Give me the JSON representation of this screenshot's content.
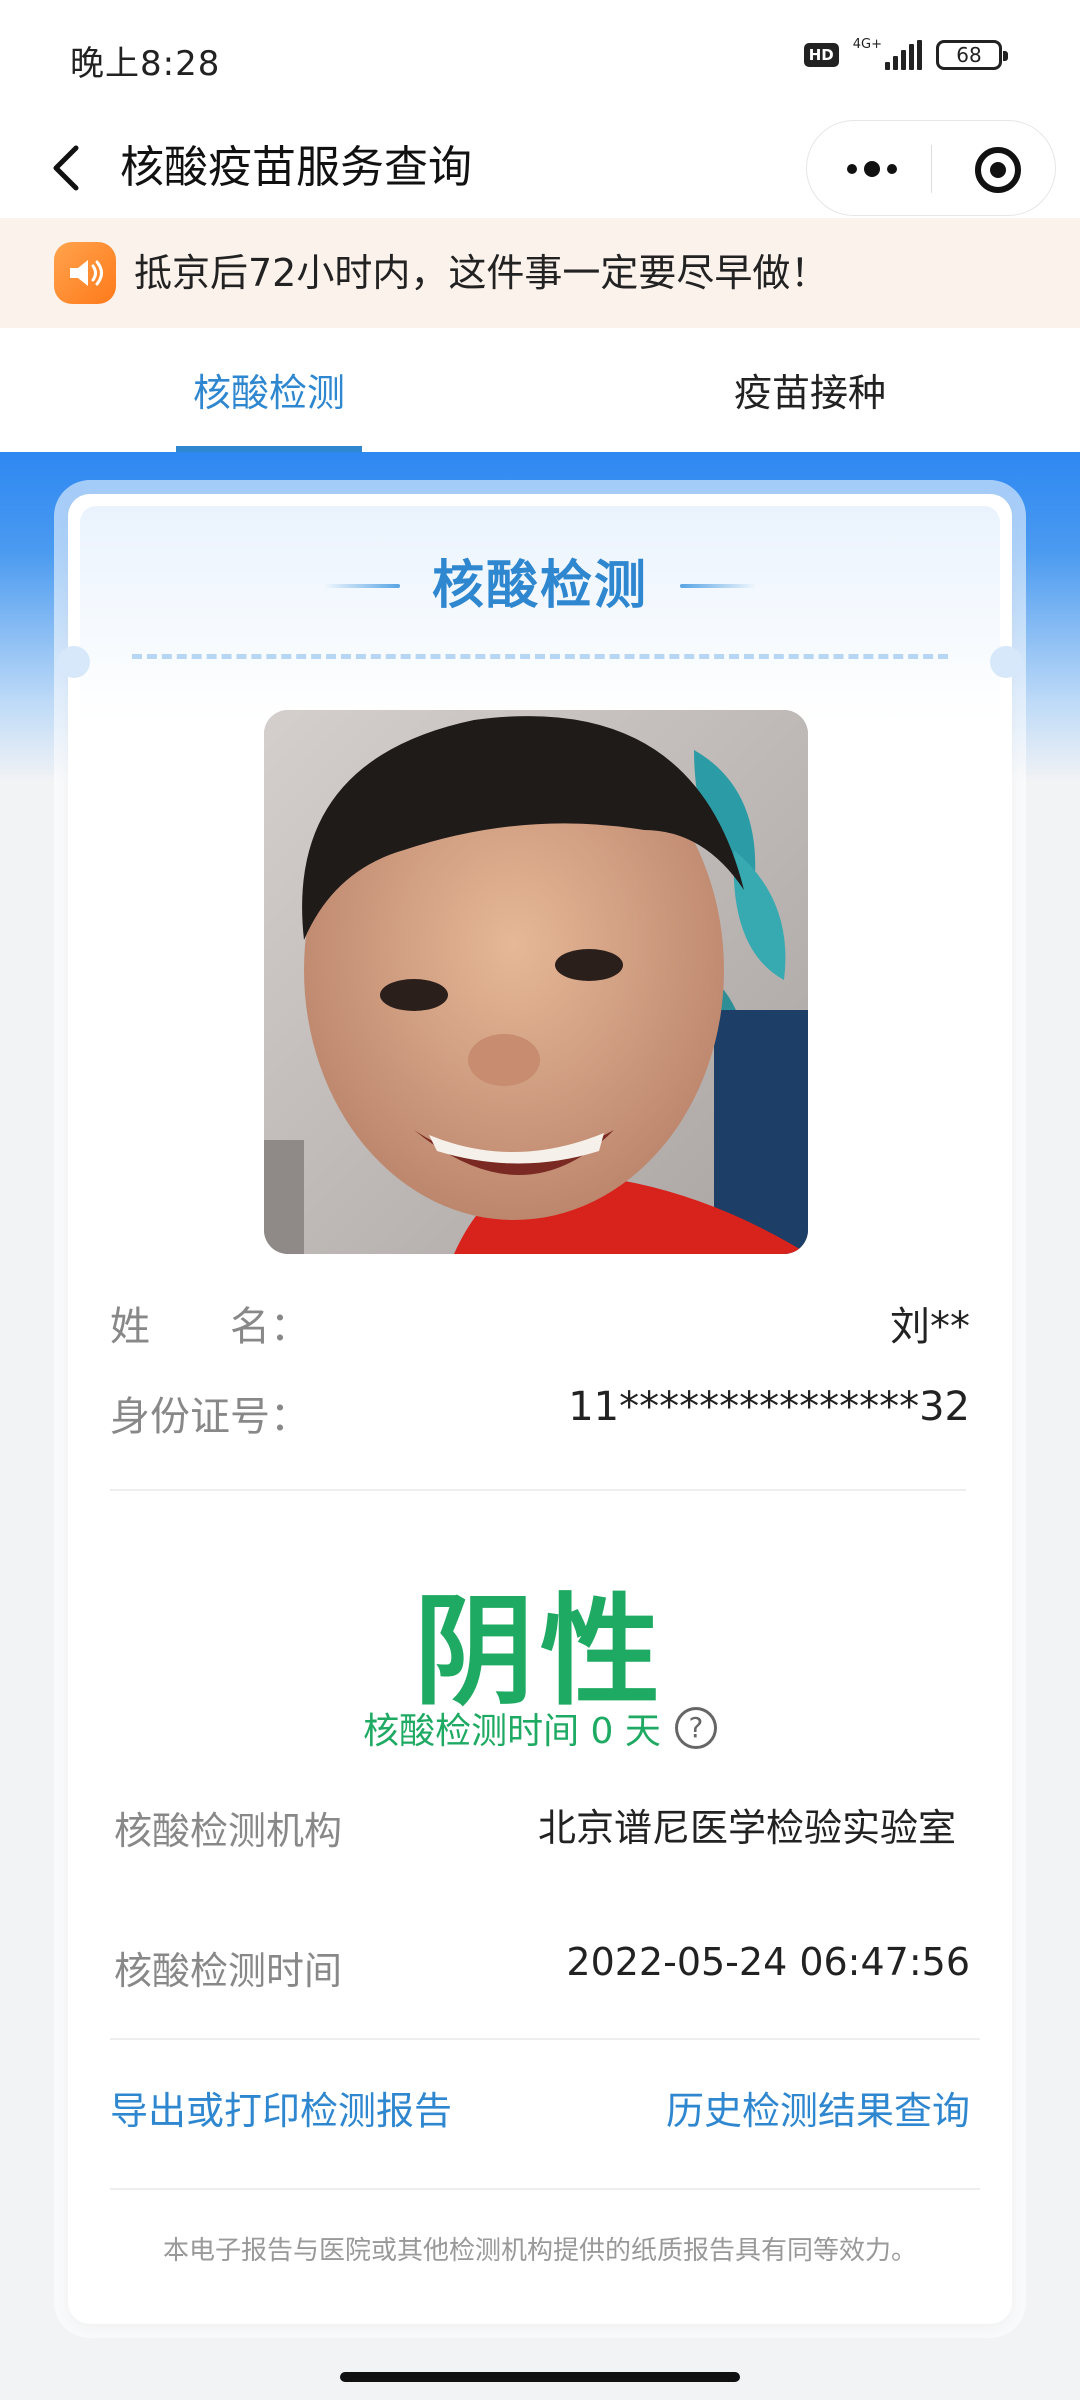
{
  "status_bar": {
    "time": "晚上8:28",
    "hd": "HD",
    "network": "4G+",
    "battery": "68"
  },
  "nav": {
    "title": "核酸疫苗服务查询"
  },
  "notice": {
    "text": "抵京后72小时内，这件事一定要尽早做！"
  },
  "tabs": [
    {
      "label": "核酸检测",
      "active": true
    },
    {
      "label": "疫苗接种",
      "active": false
    }
  ],
  "card": {
    "title": "核酸检测",
    "name_label": "姓　　名：",
    "name_value": "刘**",
    "id_label": "身份证号：",
    "id_value": "11***************32",
    "result": "阴性",
    "result_sub": "核酸检测时间 0 天",
    "help": "?",
    "org_label": "核酸检测机构",
    "org_value": "北京谱尼医学检验实验室",
    "time_label": "核酸检测时间",
    "time_value": "2022-05-24 06:47:56",
    "export_link": "导出或打印检测报告",
    "history_link": "历史检测结果查询",
    "footnote": "本电子报告与医院或其他检测机构提供的纸质报告具有同等效力。"
  },
  "colors": {
    "accent_blue": "#2f87d0",
    "result_green": "#1faa63",
    "notice_bg": "#fcf2ec"
  }
}
